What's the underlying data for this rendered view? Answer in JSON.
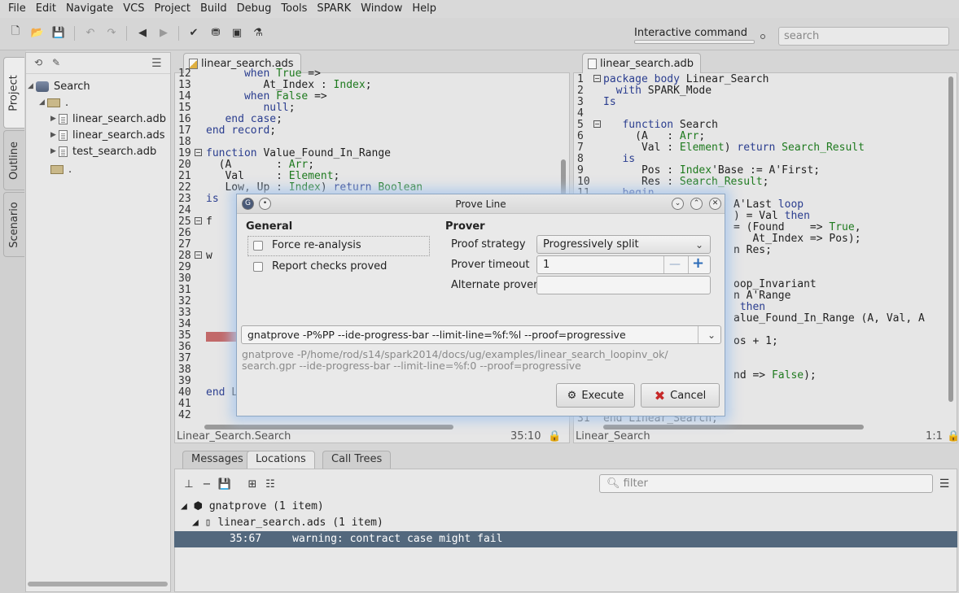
{
  "menu": [
    "File",
    "Edit",
    "Navigate",
    "VCS",
    "Project",
    "Build",
    "Debug",
    "Tools",
    "SPARK",
    "Window",
    "Help"
  ],
  "toolbar": {
    "interactive_label": "Interactive command",
    "search_placeholder": "search"
  },
  "side_tabs": [
    "Project",
    "Outline",
    "Scenario"
  ],
  "project": {
    "root": "Search",
    "folder1": ".",
    "files": [
      "linear_search.adb",
      "linear_search.ads",
      "test_search.adb"
    ],
    "folder2": "."
  },
  "left_editor": {
    "tab": "linear_search.ads",
    "line_numbers": [
      "12",
      "13",
      "14",
      "15",
      "16",
      "17",
      "18",
      "19",
      "20",
      "21",
      "22",
      "23",
      "24",
      "25",
      "26",
      "27",
      "28",
      "29",
      "30",
      "31",
      "32",
      "33",
      "34",
      "35",
      "36",
      "37",
      "38",
      "39",
      "40",
      "41",
      "42"
    ],
    "lines": [
      "      when True =>",
      "         At_Index : Index;",
      "      when False =>",
      "         null;",
      "   end case;",
      "end record;",
      "",
      "function Value_Found_In_Range",
      "  (A       : Arr;",
      "   Val     : Element;",
      "   Low, Up : Index) return Boolean",
      "is",
      "",
      "f",
      "",
      "",
      "w",
      "",
      "",
      "",
      "",
      "",
      "",
      "",
      "",
      "",
      "",
      "",
      "end L",
      "",
      ""
    ],
    "status_left": "Linear_Search.Search",
    "status_pos": "35:10"
  },
  "right_editor": {
    "tab": "linear_search.adb",
    "line_numbers": [
      "1",
      "2",
      "3",
      "4",
      "5",
      "6",
      "7",
      "8",
      "9",
      "10",
      "11"
    ],
    "lines": [
      "package body Linear_Search",
      "  with SPARK_Mode",
      "Is",
      "",
      "   function Search",
      "     (A   : Arr;",
      "      Val : Element) return Search_Result",
      "   is",
      "      Pos : Index'Base := A'First;",
      "      Res : Search_Result;",
      "   begin"
    ],
    "hidden_fragments": [
      "A'Last loop",
      ") = Val then",
      "= (Found    => True,",
      "   At_Index => Pos);",
      "n Res;",
      "",
      "",
      "oop_Invariant",
      "n A'Range",
      " then",
      "alue_Found_In_Range (A, Val, A",
      "",
      "os + 1;",
      "",
      "",
      "nd => False);"
    ],
    "last_line_number": "31",
    "last_line": "end Linear_Search;",
    "status_left": "Linear_Search",
    "status_pos": "1:1"
  },
  "bottom": {
    "tabs": [
      "Messages",
      "Locations",
      "Call Trees"
    ],
    "filter_placeholder": "filter",
    "rows": [
      "gnatprove (1 item)",
      "linear_search.ads (1 item)"
    ],
    "selected_loc": "35:67",
    "selected_msg": "warning: contract case might fail"
  },
  "dialog": {
    "title": "Prove Line",
    "general_heading": "General",
    "force_label": "Force re-analysis",
    "report_label": "Report checks proved",
    "prover_heading": "Prover",
    "proof_strategy_label": "Proof strategy",
    "proof_strategy_value": "Progressively split",
    "prover_timeout_label": "Prover timeout",
    "prover_timeout_value": "1",
    "alternate_prover_label": "Alternate prover",
    "alternate_prover_value": "",
    "command": "gnatprove -P%PP --ide-progress-bar --limit-line=%f:%l --proof=progressive",
    "expanded_line1": "gnatprove -P/home/rod/s14/spark2014/docs/ug/examples/linear_search_loopinv_ok/",
    "expanded_line2": "search.gpr --ide-progress-bar --limit-line=%f:0 --proof=progressive",
    "execute": "Execute",
    "cancel": "Cancel"
  }
}
